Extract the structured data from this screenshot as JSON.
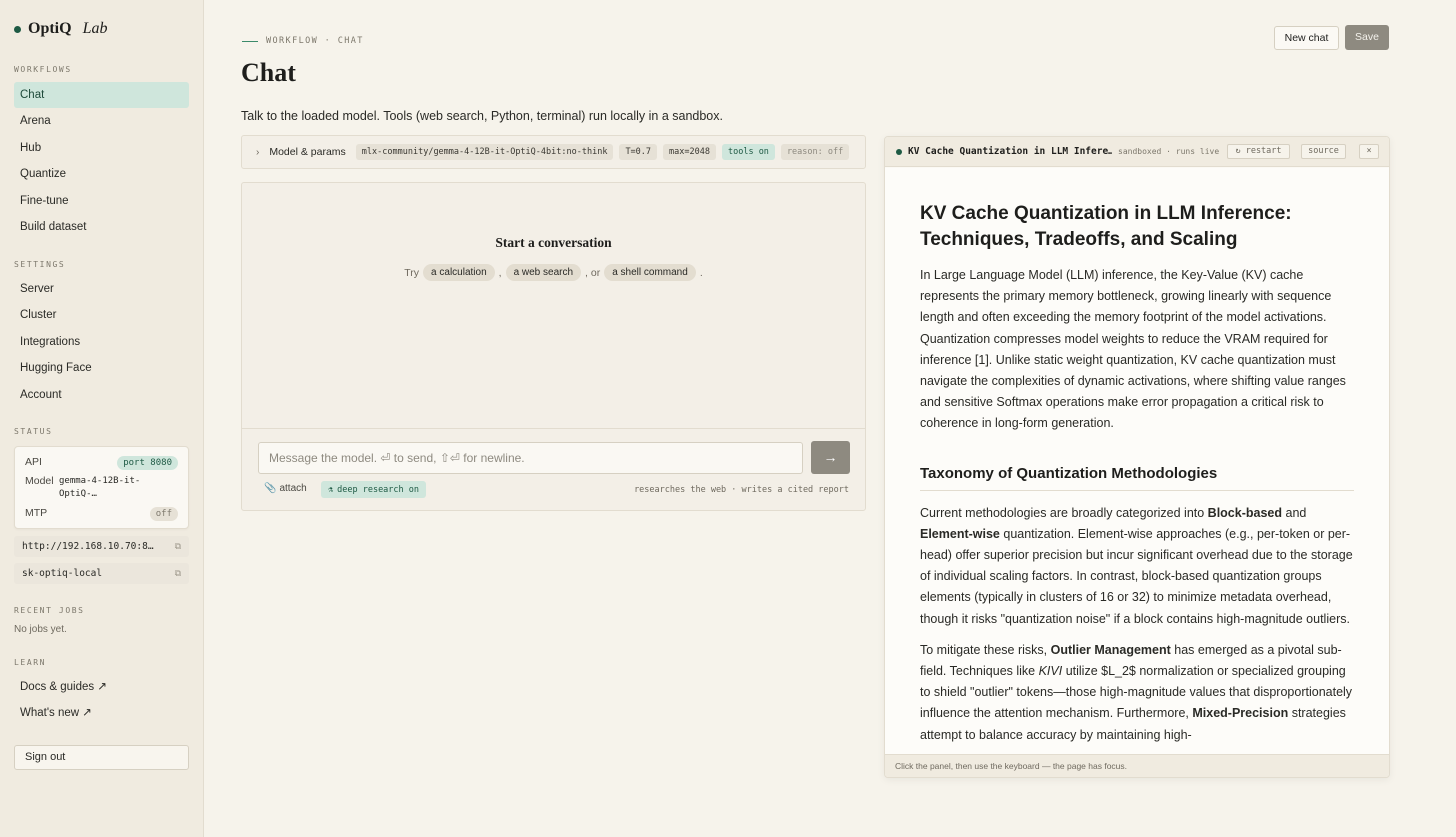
{
  "brand": {
    "name": "OptiQ",
    "sub": "Lab"
  },
  "sidebar": {
    "workflows_label": "WORKFLOWS",
    "workflows": [
      "Chat",
      "Arena",
      "Hub",
      "Quantize",
      "Fine-tune",
      "Build dataset"
    ],
    "settings_label": "SETTINGS",
    "settings": [
      "Server",
      "Cluster",
      "Integrations",
      "Hugging Face",
      "Account"
    ],
    "status_label": "STATUS",
    "status": {
      "api_key": "API",
      "api_badge": "port 8080",
      "model_key": "Model",
      "model_val": "gemma-4-12B-it-OptiQ-…",
      "mtp_key": "MTP",
      "mtp_badge": "off"
    },
    "url": "http://192.168.10.70:8…",
    "api_token": "sk-optiq-local",
    "recent_label": "RECENT JOBS",
    "recent_empty": "No jobs yet.",
    "learn_label": "LEARN",
    "learn": [
      "Docs & guides ↗",
      "What's new ↗"
    ],
    "sign_out": "Sign out"
  },
  "header": {
    "crumb": "WORKFLOW · CHAT",
    "title": "Chat",
    "new_chat": "New chat",
    "save": "Save",
    "lede": "Talk to the loaded model. Tools (web search, Python, terminal) run locally in a sandbox."
  },
  "params": {
    "label": "Model & params",
    "model": "mlx-community/gemma-4-12B-it-OptiQ-4bit:no-think",
    "temp": "T=0.7",
    "max": "max=2048",
    "tools": "tools on",
    "reason": "reason: off"
  },
  "chat": {
    "start_title": "Start a conversation",
    "try": "Try",
    "sugg1": "a calculation",
    "comma": ",",
    "sugg2": "a web search",
    "or": ", or",
    "sugg3": "a shell command",
    "period": ".",
    "placeholder": "Message the model. ⏎ to send, ⇧⏎ for newline.",
    "send": "→",
    "attach": "attach",
    "deep": "deep research on",
    "deep_note": "researches the web · writes a cited report"
  },
  "panel": {
    "title": "KV Cache Quantization in LLM Infere…",
    "note": "sandboxed · runs live",
    "restart": "↻ restart",
    "source": "source",
    "close": "×",
    "h1": "KV Cache Quantization in LLM Inference: Techniques, Tradeoffs, and Scaling",
    "p1": "In Large Language Model (LLM) inference, the Key-Value (KV) cache represents the primary memory bottleneck, growing linearly with sequence length and often exceeding the memory footprint of the model activations. Quantization compresses model weights to reduce the VRAM required for inference [1]. Unlike static weight quantization, KV cache quantization must navigate the complexities of dynamic activations, where shifting value ranges and sensitive Softmax operations make error propagation a critical risk to coherence in long-form generation.",
    "h2": "Taxonomy of Quantization Methodologies",
    "p2a": "Current methodologies are broadly categorized into ",
    "p2b": "Block-based",
    "p2c": " and ",
    "p2d": "Element-wise",
    "p2e": " quantization. Element-wise approaches (e.g., per-token or per-head) offer superior precision but incur significant overhead due to the storage of individual scaling factors. In contrast, block-based quantization groups elements (typically in clusters of 16 or 32) to minimize metadata overhead, though it risks \"quantization noise\" if a block contains high-magnitude outliers.",
    "p3a": "To mitigate these risks, ",
    "p3b": "Outlier Management",
    "p3c": " has emerged as a pivotal sub-field. Techniques like ",
    "p3d": "KIVI",
    "p3e": " utilize $L_2$ normalization or specialized grouping to shield \"outlier\" tokens—those high-magnitude values that disproportionately influence the attention mechanism. Furthermore, ",
    "p3f": "Mixed-Precision",
    "p3g": " strategies attempt to balance accuracy by maintaining high-",
    "footer": "Click the panel, then use the keyboard — the page has focus."
  }
}
